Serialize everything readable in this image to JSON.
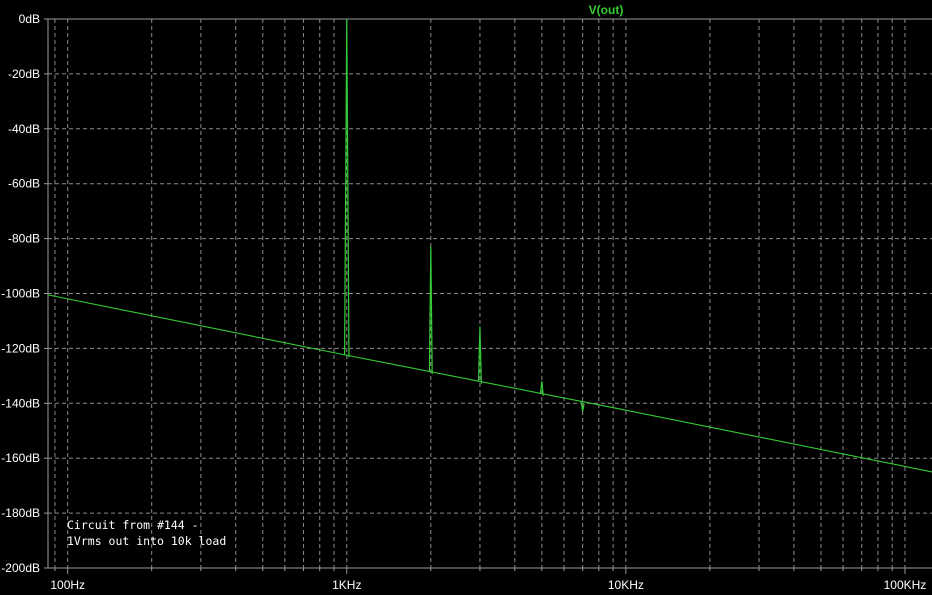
{
  "chart_data": {
    "type": "line",
    "title": "V(out)",
    "xscale": "log",
    "xlim": [
      85,
      125000
    ],
    "ylim": [
      -200,
      0
    ],
    "grid": true,
    "yticks": [
      {
        "value": 0,
        "label": "0dB"
      },
      {
        "value": -20,
        "label": "-20dB"
      },
      {
        "value": -40,
        "label": "-40dB"
      },
      {
        "value": -60,
        "label": "-60dB"
      },
      {
        "value": -80,
        "label": "-80dB"
      },
      {
        "value": -100,
        "label": "-100dB"
      },
      {
        "value": -120,
        "label": "-120dB"
      },
      {
        "value": -140,
        "label": "-140dB"
      },
      {
        "value": -160,
        "label": "-160dB"
      },
      {
        "value": -180,
        "label": "-180dB"
      },
      {
        "value": -200,
        "label": "-200dB"
      }
    ],
    "xticks": [
      {
        "value": 100,
        "label": "100Hz"
      },
      {
        "value": 1000,
        "label": "1KHz"
      },
      {
        "value": 10000,
        "label": "10KHz"
      },
      {
        "value": 100000,
        "label": "100KHz"
      }
    ],
    "series": [
      {
        "name": "V(out)",
        "color": "#33cc33",
        "noise_floor": [
          {
            "x": 85,
            "y": -100.5
          },
          {
            "x": 1000,
            "y": -122.5
          },
          {
            "x": 10000,
            "y": -142.5
          },
          {
            "x": 125000,
            "y": -165
          }
        ],
        "peaks": [
          {
            "x": 1000,
            "y": 0
          },
          {
            "x": 2000,
            "y": -83
          },
          {
            "x": 3000,
            "y": -112
          },
          {
            "x": 5000,
            "y": -132
          },
          {
            "x": 7000,
            "y": -143
          }
        ]
      }
    ],
    "annotation": [
      "Circuit from #144 -",
      "1Vrms out into 10k load"
    ]
  }
}
